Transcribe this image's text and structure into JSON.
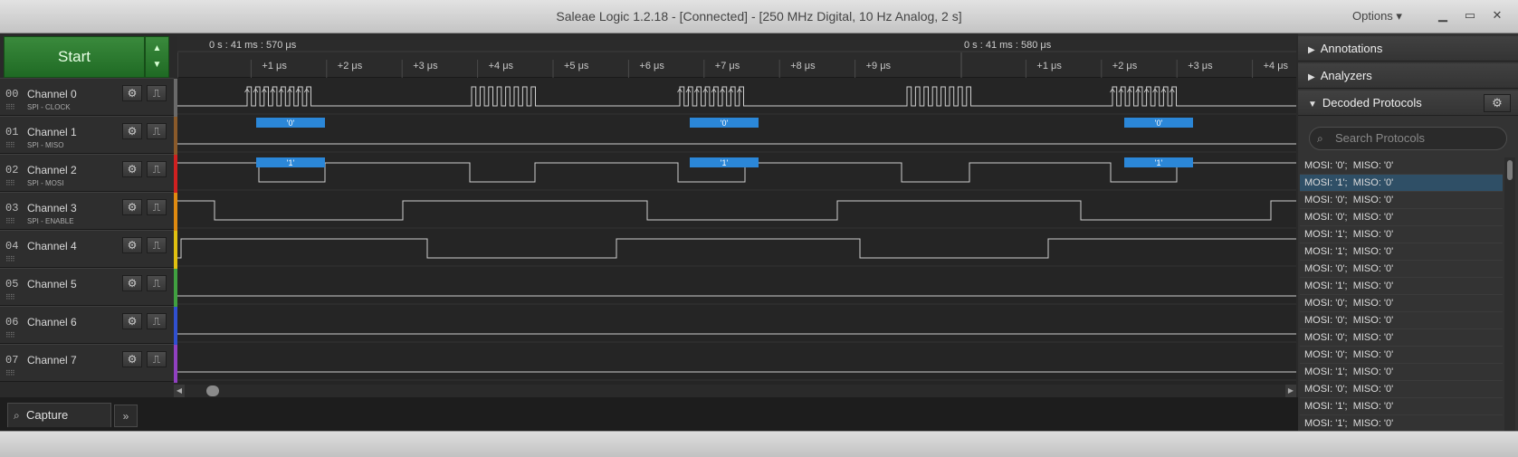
{
  "window": {
    "title": "Saleae Logic 1.2.18 - [Connected] - [250 MHz Digital, 10 Hz Analog, 2 s]",
    "options_label": "Options ▾",
    "min": "▁",
    "max": "▭",
    "close": "✕"
  },
  "start": {
    "label": "Start",
    "up": "▲",
    "down": "▼"
  },
  "timebar": {
    "ref_left": "0 s : 41 ms : 570 μs",
    "ref_right": "0 s : 41 ms : 580 μs",
    "ticks_left": [
      "+1 μs",
      "+2 μs",
      "+3 μs",
      "+4 μs",
      "+5 μs",
      "+6 μs",
      "+7 μs",
      "+8 μs",
      "+9 μs"
    ],
    "ticks_right": [
      "+1 μs",
      "+2 μs",
      "+3 μs",
      "+4 μs"
    ]
  },
  "channels": [
    {
      "num": "00",
      "name": "Channel 0",
      "sub": "SPI - CLOCK",
      "color": "#6a6a6a"
    },
    {
      "num": "01",
      "name": "Channel 1",
      "sub": "SPI - MISO",
      "color": "#8a5a2a"
    },
    {
      "num": "02",
      "name": "Channel 2",
      "sub": "SPI - MOSI",
      "color": "#d02020"
    },
    {
      "num": "03",
      "name": "Channel 3",
      "sub": "SPI - ENABLE",
      "color": "#e08a10"
    },
    {
      "num": "04",
      "name": "Channel 4",
      "sub": "",
      "color": "#e0c010"
    },
    {
      "num": "05",
      "name": "Channel 5",
      "sub": "",
      "color": "#40a040"
    },
    {
      "num": "06",
      "name": "Channel 6",
      "sub": "",
      "color": "#3050d0"
    },
    {
      "num": "07",
      "name": "Channel 7",
      "sub": "",
      "color": "#9040c0"
    }
  ],
  "icons": {
    "channel_settings": "gear-icon",
    "channel_trigger": "edge-trigger-icon",
    "search": "magnifier-icon"
  },
  "decode_labels": {
    "miso": "'0'",
    "mosi": "'1'"
  },
  "tabs": {
    "capture": "Capture",
    "more": "»"
  },
  "right_panel": {
    "annotations": "Annotations",
    "analyzers": "Analyzers",
    "decoded": "Decoded Protocols",
    "search_placeholder": "Search Protocols",
    "rows": [
      "MOSI: '0';  MISO: '0'",
      "MOSI: '1';  MISO: '0'",
      "MOSI: '0';  MISO: '0'",
      "MOSI: '0';  MISO: '0'",
      "MOSI: '1';  MISO: '0'",
      "MOSI: '1';  MISO: '0'",
      "MOSI: '0';  MISO: '0'",
      "MOSI: '1';  MISO: '0'",
      "MOSI: '0';  MISO: '0'",
      "MOSI: '0';  MISO: '0'",
      "MOSI: '0';  MISO: '0'",
      "MOSI: '0';  MISO: '0'",
      "MOSI: '1';  MISO: '0'",
      "MOSI: '0';  MISO: '0'",
      "MOSI: '1';  MISO: '0'",
      "MOSI: '1';  MISO: '0'"
    ],
    "selected_row": 1
  }
}
